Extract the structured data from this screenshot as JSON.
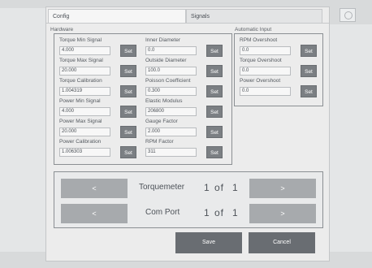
{
  "tabs": [
    {
      "label": "Config",
      "active": true
    },
    {
      "label": "Signals",
      "active": false
    }
  ],
  "sections": {
    "hardware": "Hardware",
    "automatic_input": "Automatic Input"
  },
  "set_label": "Set",
  "hardware_left": [
    {
      "label": "Torque Min Signal",
      "value": "4.000"
    },
    {
      "label": "Torque Max Signal",
      "value": "20.000"
    },
    {
      "label": "Torque Calibration",
      "value": "1.004319"
    },
    {
      "label": "Power Min Signal",
      "value": "4.000"
    },
    {
      "label": "Power Max Signal",
      "value": "20.000"
    },
    {
      "label": "Power Calibration",
      "value": "1.006303"
    }
  ],
  "hardware_right": [
    {
      "label": "Inner Diameter",
      "value": "0.0"
    },
    {
      "label": "Outside Diameter",
      "value": "100.0"
    },
    {
      "label": "Poisson Coefficient",
      "value": "0.300"
    },
    {
      "label": "Elastic Modulus",
      "value": "206800"
    },
    {
      "label": "Gauge Factor",
      "value": "2.000"
    },
    {
      "label": "RPM Factor",
      "value": "311"
    }
  ],
  "automatic_input": [
    {
      "label": "RPM Overshoot",
      "value": "0.0"
    },
    {
      "label": "Torque Overshoot",
      "value": "0.0"
    },
    {
      "label": "Power Overshoot",
      "value": "0.0"
    }
  ],
  "selectors": [
    {
      "prev": "<",
      "name": "Torquemeter",
      "current": "1",
      "of": "of",
      "total": "1",
      "next": ">"
    },
    {
      "prev": "<",
      "name": "Com Port",
      "current": "1",
      "of": "of",
      "total": "1",
      "next": ">"
    }
  ],
  "buttons": {
    "save": "Save",
    "cancel": "Cancel"
  },
  "colors": {
    "set_button": "#7b7f83",
    "nav_button": "#a7aaad",
    "action_button": "#696d72"
  },
  "icons": [
    "power-icon"
  ]
}
